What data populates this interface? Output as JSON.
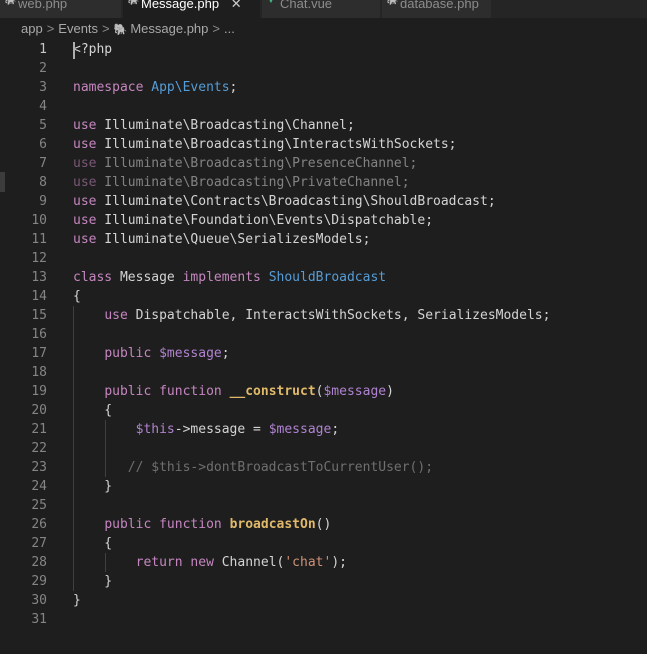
{
  "tabs": [
    {
      "label": "web.php",
      "icon": "php-elephant-icon",
      "active": false
    },
    {
      "label": "Message.php",
      "icon": "php-elephant-icon",
      "active": true,
      "close": "✕"
    },
    {
      "label": "Chat.vue",
      "icon": "vue-icon",
      "active": false
    },
    {
      "label": "database.php",
      "icon": "php-elephant-icon",
      "active": false
    }
  ],
  "breadcrumb": {
    "items": [
      "app",
      "Events",
      "Message.php",
      "..."
    ],
    "separator": ">"
  },
  "editor": {
    "language": "php",
    "cursor_line": 1,
    "lines": [
      {
        "n": "1",
        "segments": [
          {
            "t": "<?php",
            "c": "plain"
          }
        ]
      },
      {
        "n": "2",
        "segments": []
      },
      {
        "n": "3",
        "segments": [
          {
            "t": "namespace",
            "c": "kw2"
          },
          {
            "t": " App\\Events",
            "c": "ns"
          },
          {
            "t": ";",
            "c": "plain"
          }
        ]
      },
      {
        "n": "4",
        "segments": []
      },
      {
        "n": "5",
        "segments": [
          {
            "t": "use",
            "c": "kw2"
          },
          {
            "t": " Illuminate\\Broadcasting\\Channel;",
            "c": "plain"
          }
        ]
      },
      {
        "n": "6",
        "segments": [
          {
            "t": "use",
            "c": "kw2"
          },
          {
            "t": " Illuminate\\Broadcasting\\InteractsWithSockets;",
            "c": "plain"
          }
        ]
      },
      {
        "n": "7",
        "dim": true,
        "segments": [
          {
            "t": "use",
            "c": "kw2"
          },
          {
            "t": " Illuminate\\Broadcasting\\PresenceChannel;",
            "c": "plain"
          }
        ]
      },
      {
        "n": "8",
        "dim": true,
        "segments": [
          {
            "t": "use",
            "c": "kw2"
          },
          {
            "t": " Illuminate\\Broadcasting\\PrivateChannel;",
            "c": "plain"
          }
        ]
      },
      {
        "n": "9",
        "segments": [
          {
            "t": "use",
            "c": "kw2"
          },
          {
            "t": " Illuminate\\Contracts\\Broadcasting\\ShouldBroadcast;",
            "c": "plain"
          }
        ]
      },
      {
        "n": "10",
        "segments": [
          {
            "t": "use",
            "c": "kw2"
          },
          {
            "t": " Illuminate\\Foundation\\Events\\Dispatchable;",
            "c": "plain"
          }
        ]
      },
      {
        "n": "11",
        "segments": [
          {
            "t": "use",
            "c": "kw2"
          },
          {
            "t": " Illuminate\\Queue\\SerializesModels;",
            "c": "plain"
          }
        ]
      },
      {
        "n": "12",
        "segments": []
      },
      {
        "n": "13",
        "segments": [
          {
            "t": "class",
            "c": "kw2"
          },
          {
            "t": " Message ",
            "c": "plain"
          },
          {
            "t": "implements",
            "c": "kw2"
          },
          {
            "t": " ShouldBroadcast",
            "c": "ns"
          }
        ]
      },
      {
        "n": "14",
        "segments": [
          {
            "t": "{",
            "c": "plain"
          }
        ]
      },
      {
        "n": "15",
        "segments": [
          {
            "t": "    ",
            "c": "plain"
          },
          {
            "t": "use",
            "c": "kw2"
          },
          {
            "t": " Dispatchable, InteractsWithSockets, SerializesModels;",
            "c": "plain"
          }
        ]
      },
      {
        "n": "16",
        "segments": []
      },
      {
        "n": "17",
        "segments": [
          {
            "t": "    ",
            "c": "plain"
          },
          {
            "t": "public",
            "c": "kw2"
          },
          {
            "t": " ",
            "c": "plain"
          },
          {
            "t": "$message",
            "c": "var"
          },
          {
            "t": ";",
            "c": "plain"
          }
        ]
      },
      {
        "n": "18",
        "segments": []
      },
      {
        "n": "19",
        "segments": [
          {
            "t": "    ",
            "c": "plain"
          },
          {
            "t": "public",
            "c": "kw2"
          },
          {
            "t": " ",
            "c": "plain"
          },
          {
            "t": "function",
            "c": "kw2"
          },
          {
            "t": " ",
            "c": "plain"
          },
          {
            "t": "__construct",
            "c": "fn"
          },
          {
            "t": "(",
            "c": "plain"
          },
          {
            "t": "$message",
            "c": "var"
          },
          {
            "t": ")",
            "c": "plain"
          }
        ]
      },
      {
        "n": "20",
        "segments": [
          {
            "t": "    {",
            "c": "plain"
          }
        ]
      },
      {
        "n": "21",
        "segments": [
          {
            "t": "        ",
            "c": "plain"
          },
          {
            "t": "$this",
            "c": "var"
          },
          {
            "t": "->",
            "c": "plain"
          },
          {
            "t": "message",
            "c": "prop"
          },
          {
            "t": " = ",
            "c": "plain"
          },
          {
            "t": "$message",
            "c": "var"
          },
          {
            "t": ";",
            "c": "plain"
          }
        ]
      },
      {
        "n": "22",
        "segments": []
      },
      {
        "n": "23",
        "segments": [
          {
            "t": "       ",
            "c": "plain"
          },
          {
            "t": "// $this->dontBroadcastToCurrentUser();",
            "c": "cmt"
          }
        ]
      },
      {
        "n": "24",
        "segments": [
          {
            "t": "    }",
            "c": "plain"
          }
        ]
      },
      {
        "n": "25",
        "segments": []
      },
      {
        "n": "26",
        "segments": [
          {
            "t": "    ",
            "c": "plain"
          },
          {
            "t": "public",
            "c": "kw2"
          },
          {
            "t": " ",
            "c": "plain"
          },
          {
            "t": "function",
            "c": "kw2"
          },
          {
            "t": " ",
            "c": "plain"
          },
          {
            "t": "broadcastOn",
            "c": "fn"
          },
          {
            "t": "()",
            "c": "plain"
          }
        ]
      },
      {
        "n": "27",
        "segments": [
          {
            "t": "    {",
            "c": "plain"
          }
        ]
      },
      {
        "n": "28",
        "segments": [
          {
            "t": "        ",
            "c": "plain"
          },
          {
            "t": "return",
            "c": "kw2"
          },
          {
            "t": " ",
            "c": "plain"
          },
          {
            "t": "new",
            "c": "kw2"
          },
          {
            "t": " Channel(",
            "c": "plain"
          },
          {
            "t": "'chat'",
            "c": "str"
          },
          {
            "t": ");",
            "c": "plain"
          }
        ]
      },
      {
        "n": "29",
        "segments": [
          {
            "t": "    }",
            "c": "plain"
          }
        ]
      },
      {
        "n": "30",
        "segments": [
          {
            "t": "}",
            "c": "plain"
          }
        ]
      },
      {
        "n": "31",
        "segments": []
      }
    ]
  },
  "colors": {
    "background": "#1e1e1e",
    "keyword": "#c586c0",
    "namespace": "#569cd6",
    "function": "#e0b96a",
    "variable": "#b083d0",
    "string": "#ce9178",
    "comment": "#6f6f6f"
  }
}
